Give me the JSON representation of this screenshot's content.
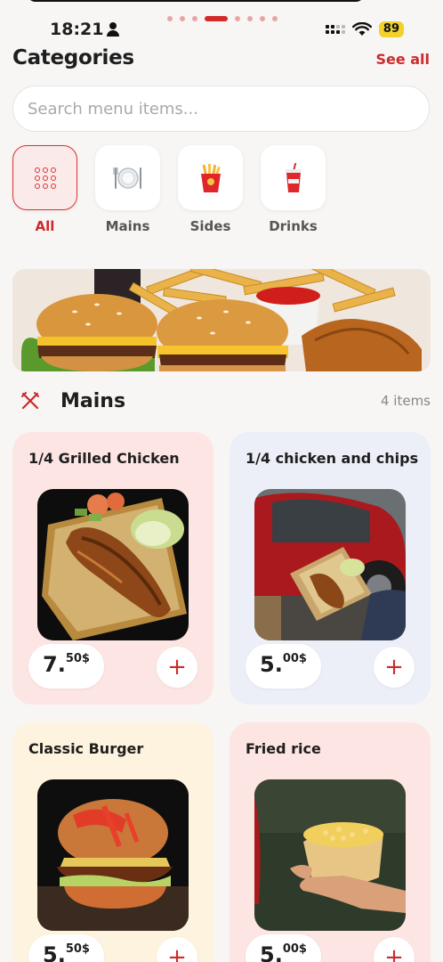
{
  "status": {
    "time": "18:21",
    "battery": "89"
  },
  "header": {
    "title": "Categories",
    "see_all": "See all"
  },
  "search": {
    "placeholder": "Search menu items..."
  },
  "categories": [
    {
      "label": "All",
      "icon": "grid-icon",
      "active": true
    },
    {
      "label": "Mains",
      "icon": "plate-icon",
      "active": false
    },
    {
      "label": "Sides",
      "icon": "fries-icon",
      "active": false
    },
    {
      "label": "Drinks",
      "icon": "drink-icon",
      "active": false
    }
  ],
  "section": {
    "title": "Mains",
    "count": "4 items",
    "icon": "utensils-cross-icon"
  },
  "items": [
    {
      "name": "1/4 Grilled Chicken",
      "price_main": "7.",
      "price_cents": "50$",
      "bg": "#fce5e2"
    },
    {
      "name": "1/4 chicken and chips",
      "price_main": "5.",
      "price_cents": "00$",
      "bg": "#eceef8"
    },
    {
      "name": "Classic Burger",
      "price_main": "5.",
      "price_cents": "50$",
      "bg": "#fdf3de"
    },
    {
      "name": "Fried rice",
      "price_main": "5.",
      "price_cents": "00$",
      "bg": "#fce5e2"
    }
  ],
  "accent": "#cc2b2b"
}
